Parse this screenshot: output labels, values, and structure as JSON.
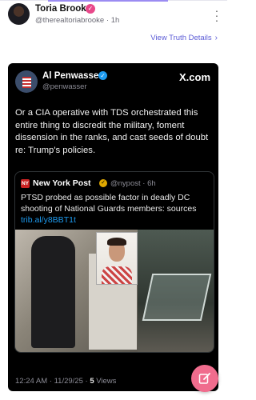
{
  "post": {
    "author_name": "Toria Brooke",
    "author_handle": "@therealtoriabrooke",
    "time": "1h",
    "view_details": "View Truth Details"
  },
  "quoted": {
    "name": "Al Penwasser",
    "handle": "@penwasser",
    "platform": "X.com",
    "text": "Or a CIA operative with TDS orchestrated this entire thing to discredit the military, foment dissension in the ranks, and cast seeds of doubt re: Trump's policies.",
    "nested": {
      "name": "New York Post",
      "handle": "@nypost",
      "time": "6h",
      "text": "PTSD probed as possible factor in deadly DC shooting of National Guards members: sources",
      "link": "trib.al/y8BBT1t"
    },
    "timestamp": "12:24 AM · 11/29/25 · ",
    "views_count": "5",
    "views_label": " Views"
  },
  "icons": {
    "more": "more-vertical-icon",
    "chevron": "chevron-right-icon",
    "compose": "compose-icon"
  },
  "colors": {
    "accent": "#5b5bd6",
    "fab": "#f06c8d",
    "verified_pink": "#e8488a",
    "verified_blue": "#1d9bf0"
  }
}
